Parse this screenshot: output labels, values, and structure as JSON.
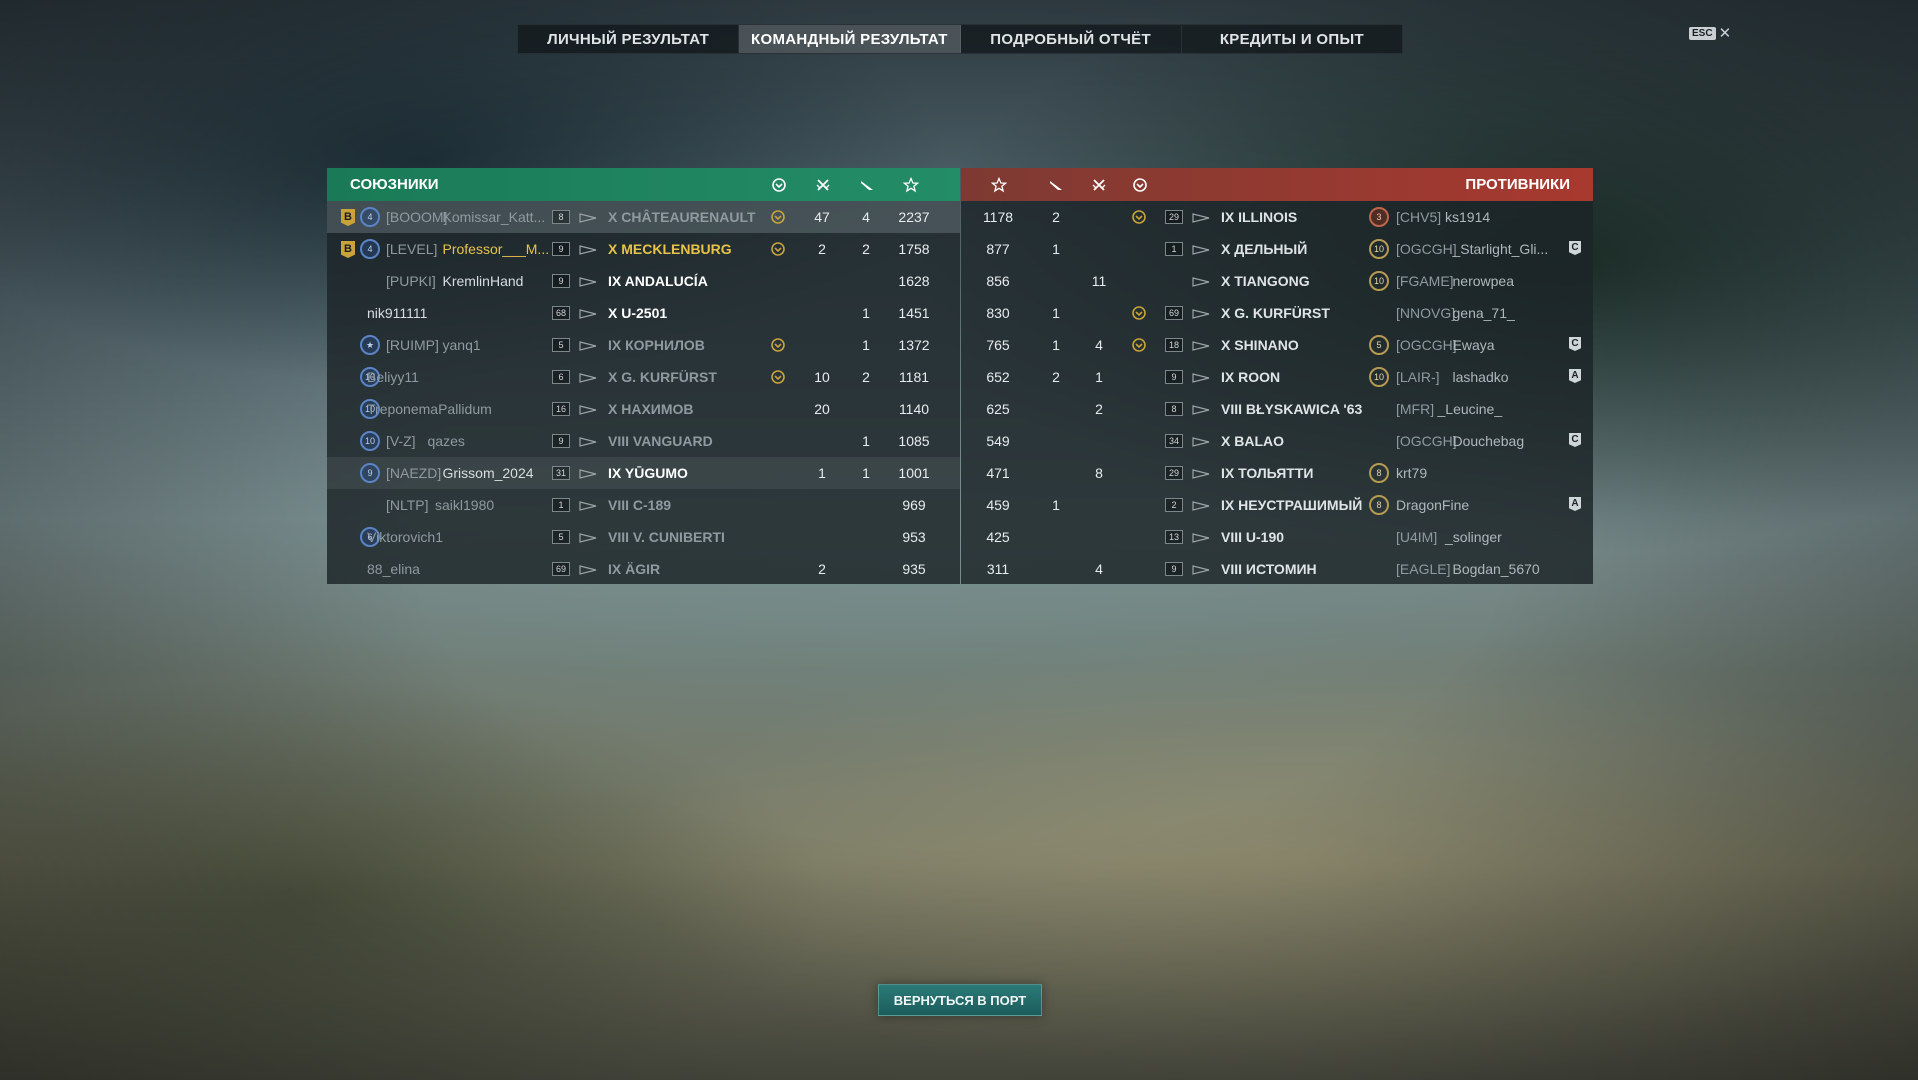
{
  "tabs": [
    "ЛИЧНЫЙ РЕЗУЛЬТАТ",
    "КОМАНДНЫЙ РЕЗУЛЬТАТ",
    "ПОДРОБНЫЙ ОТЧЁТ",
    "КРЕДИТЫ И ОПЫТ"
  ],
  "active_tab": "КОМАНДНЫЙ РЕЗУЛЬТАТ",
  "esc": {
    "key": "ESC",
    "close": "✕"
  },
  "allies": {
    "title": "СОЮЗНИКИ",
    "color": "#238d67",
    "columns": [
      "ribbon-icon",
      "kills-icon",
      "planes-icon",
      "xp-star-icon"
    ],
    "rows": [
      {
        "div": "B",
        "rank": "4",
        "clan": "[BOOOM]",
        "name": "Komissar_Katt...",
        "lvl": "8",
        "ship": "X CHÂTEAURENAULT",
        "rib": true,
        "kills": "47",
        "planes": "4",
        "xp": "2237",
        "style": "dim",
        "hl": "hl"
      },
      {
        "div": "B",
        "rank": "4",
        "clan": "[LEVEL]",
        "name": "Professor___M...",
        "lvl": "9",
        "ship": "X MECKLENBURG",
        "rib": true,
        "kills": "2",
        "planes": "2",
        "xp": "1758",
        "style": "gold",
        "hl": ""
      },
      {
        "div": "",
        "rank": "",
        "clan": "[PUPKI]",
        "name": "KremlinHand",
        "lvl": "9",
        "ship": "IX ANDALUCÍA",
        "rib": false,
        "kills": "",
        "planes": "",
        "xp": "1628",
        "style": "bright",
        "hl": ""
      },
      {
        "div": "",
        "rank": "",
        "clan": "",
        "name": "nik911111",
        "lvl": "68",
        "ship": "X U-2501",
        "rib": false,
        "kills": "",
        "planes": "1",
        "xp": "1451",
        "style": "bright",
        "hl": ""
      },
      {
        "div": "",
        "rank": "★",
        "clan": "[RUIMP]",
        "name": "yanq1",
        "lvl": "5",
        "ship": "IX КОРНИЛОВ",
        "rib": true,
        "kills": "",
        "planes": "1",
        "xp": "1372",
        "style": "dim",
        "hl": ""
      },
      {
        "div": "",
        "rank": "10",
        "clan": "",
        "name": "Beliyy11",
        "lvl": "6",
        "ship": "X G. KURFÜRST",
        "rib": true,
        "kills": "10",
        "planes": "2",
        "xp": "1181",
        "style": "dim",
        "hl": ""
      },
      {
        "div": "",
        "rank": "10",
        "clan": "",
        "name": "TreponemaPallidum",
        "lvl": "16",
        "ship": "X НАХИМОВ",
        "rib": false,
        "kills": "20",
        "planes": "",
        "xp": "1140",
        "style": "dim",
        "hl": ""
      },
      {
        "div": "",
        "rank": "10",
        "clan": "[V-Z]",
        "name": "qazes",
        "lvl": "9",
        "ship": "VIII VANGUARD",
        "rib": false,
        "kills": "",
        "planes": "1",
        "xp": "1085",
        "style": "dim",
        "hl": ""
      },
      {
        "div": "",
        "rank": "9",
        "clan": "[NAEZD]",
        "name": "Grissom_2024",
        "lvl": "31",
        "ship": "IX YŪGUMO",
        "rib": false,
        "kills": "1",
        "planes": "1",
        "xp": "1001",
        "style": "bright",
        "hl": "hl2"
      },
      {
        "div": "",
        "rank": "",
        "clan": "[NLTP]",
        "name": "saikl1980",
        "lvl": "1",
        "ship": "VIII C-189",
        "rib": false,
        "kills": "",
        "planes": "",
        "xp": "969",
        "style": "dim",
        "hl": ""
      },
      {
        "div": "",
        "rank": "6",
        "clan": "",
        "name": "Viktorovich1",
        "lvl": "5",
        "ship": "VIII V. CUNIBERTI",
        "rib": false,
        "kills": "",
        "planes": "",
        "xp": "953",
        "style": "dim",
        "hl": ""
      },
      {
        "div": "",
        "rank": "",
        "clan": "",
        "name": "88_elina",
        "lvl": "69",
        "ship": "IX ÄGIR",
        "rib": false,
        "kills": "2",
        "planes": "",
        "xp": "935",
        "style": "dim",
        "hl": ""
      }
    ]
  },
  "enemies": {
    "title": "ПРОТИВНИКИ",
    "color": "#a8392f",
    "rows": [
      {
        "xp": "1178",
        "planes": "2",
        "kills": "",
        "rib": true,
        "lvl": "29",
        "ship": "IX ILLINOIS",
        "rank": "3",
        "rank_style": "red",
        "clan": "[CHV5]",
        "name": "ks1914",
        "tag": "",
        "style": "dim"
      },
      {
        "xp": "877",
        "planes": "1",
        "kills": "",
        "rib": false,
        "lvl": "1",
        "ship": "X ДЕЛЬНЫЙ",
        "rank": "10",
        "rank_style": "gold",
        "clan": "[OGCGH]",
        "name": "_Starlight_Gli...",
        "tag": "C",
        "style": "dim"
      },
      {
        "xp": "856",
        "planes": "",
        "kills": "11",
        "rib": false,
        "lvl": "",
        "ship": "X TIANGONG",
        "rank": "10",
        "rank_style": "gold",
        "clan": "[FGAME]",
        "name": "nerowpea",
        "tag": "",
        "style": "dim"
      },
      {
        "xp": "830",
        "planes": "1",
        "kills": "",
        "rib": true,
        "lvl": "69",
        "ship": "X G. KURFÜRST",
        "rank": "",
        "rank_style": "",
        "clan": "[NNOVG]",
        "name": "gena_71_",
        "tag": "",
        "style": "dim"
      },
      {
        "xp": "765",
        "planes": "1",
        "kills": "4",
        "rib": true,
        "lvl": "18",
        "ship": "X SHINANO",
        "rank": "5",
        "rank_style": "gold",
        "clan": "[OGCGH]",
        "name": "Ewaya",
        "tag": "C",
        "style": "dim"
      },
      {
        "xp": "652",
        "planes": "2",
        "kills": "1",
        "rib": false,
        "lvl": "9",
        "ship": "IX ROON",
        "rank": "10",
        "rank_style": "gold",
        "clan": "[LAIR-]",
        "name": "lashadko",
        "tag": "A",
        "style": "dim"
      },
      {
        "xp": "625",
        "planes": "",
        "kills": "2",
        "rib": false,
        "lvl": "8",
        "ship": "VIII BŁYSKAWICA '63",
        "rank": "",
        "rank_style": "",
        "clan": "[MFR]",
        "name": "_Leucine_",
        "tag": "",
        "style": "dim"
      },
      {
        "xp": "549",
        "planes": "",
        "kills": "",
        "rib": false,
        "lvl": "34",
        "ship": "X BALAO",
        "rank": "",
        "rank_style": "",
        "clan": "[OGCGH]",
        "name": "Douchebag",
        "tag": "C",
        "style": "dim"
      },
      {
        "xp": "471",
        "planes": "",
        "kills": "8",
        "rib": false,
        "lvl": "29",
        "ship": "IX ТОЛЬЯТТИ",
        "rank": "8",
        "rank_style": "gold",
        "clan": "",
        "name": "krt79",
        "tag": "",
        "style": "dim"
      },
      {
        "xp": "459",
        "planes": "1",
        "kills": "",
        "rib": false,
        "lvl": "2",
        "ship": "IX НЕУСТРАШИМЫЙ",
        "rank": "8",
        "rank_style": "gold",
        "clan": "",
        "name": "DragonFine",
        "tag": "A",
        "style": "dim"
      },
      {
        "xp": "425",
        "planes": "",
        "kills": "",
        "rib": false,
        "lvl": "13",
        "ship": "VIII U-190",
        "rank": "",
        "rank_style": "",
        "clan": "[U4IM]",
        "name": "_solinger",
        "tag": "",
        "style": "dim"
      },
      {
        "xp": "311",
        "planes": "",
        "kills": "4",
        "rib": false,
        "lvl": "9",
        "ship": "VIII ИСТОМИН",
        "rank": "",
        "rank_style": "",
        "clan": "[EAGLE]",
        "name": "Bogdan_5670",
        "tag": "",
        "style": "dim"
      }
    ]
  },
  "back_button": "ВЕРНУТЬСЯ В ПОРТ"
}
